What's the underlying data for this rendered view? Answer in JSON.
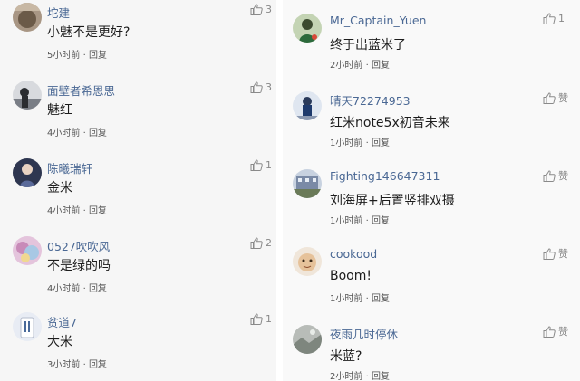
{
  "left_comments": [
    {
      "username": "坨建",
      "content": "小魅不是更好?",
      "time": "5小时前",
      "separator": "·",
      "reply": "回复",
      "likes": "3",
      "avatar_color": "#8a7866"
    },
    {
      "username": "面壁者希恩思",
      "content": "魅红",
      "time": "4小时前",
      "separator": "·",
      "reply": "回复",
      "likes": "3",
      "avatar_color": "#5a5e66"
    },
    {
      "username": "陈曦瑞轩",
      "content": "金米",
      "time": "4小时前",
      "separator": "·",
      "reply": "回复",
      "likes": "1",
      "avatar_color": "#3c4660"
    },
    {
      "username": "0527吹吹风",
      "content": "不是绿的吗",
      "time": "4小时前",
      "separator": "·",
      "reply": "回复",
      "likes": "2",
      "avatar_color": "#c9a0c4"
    },
    {
      "username": "贫道7",
      "content": "大米",
      "time": "3小时前",
      "separator": "·",
      "reply": "回复",
      "likes": "1",
      "avatar_color": "#9aa6c0"
    }
  ],
  "right_comments": [
    {
      "username": "Mr_Captain_Yuen",
      "content": "终于出蓝米了",
      "time": "2小时前",
      "separator": "·",
      "reply": "回复",
      "likes": "1",
      "avatar_color": "#6a8a5c"
    },
    {
      "username": "晴天72274953",
      "content": "红米note5x初音未来",
      "time": "1小时前",
      "separator": "·",
      "reply": "回复",
      "likes": "赞",
      "avatar_color": "#38527a"
    },
    {
      "username": "Fighting146647311",
      "content": "刘海屏+后置竖排双摄",
      "time": "1小时前",
      "separator": "·",
      "reply": "回复",
      "likes": "赞",
      "avatar_color": "#5e6e88"
    },
    {
      "username": "cookood",
      "content": "Boom!",
      "time": "1小时前",
      "separator": "·",
      "reply": "回复",
      "likes": "赞",
      "avatar_color": "#d8b896"
    },
    {
      "username": "夜雨几时停休",
      "content": "米蓝?",
      "time": "2小时前",
      "separator": "·",
      "reply": "回复",
      "likes": "赞",
      "avatar_color": "#9aa09c"
    }
  ]
}
